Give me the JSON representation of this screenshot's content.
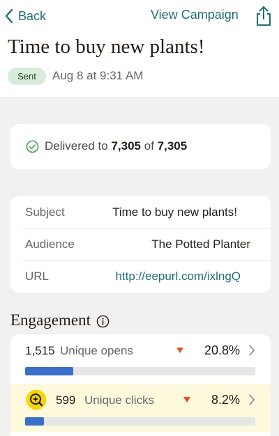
{
  "nav": {
    "back_label": "Back",
    "view_campaign_label": "View Campaign",
    "share_icon": "share-icon"
  },
  "campaign": {
    "title": "Time to buy new plants!",
    "status_badge": "Sent",
    "sent_date": "Aug 8 at 9:31 AM"
  },
  "delivery": {
    "prefix": "Delivered to",
    "delivered": "7,305",
    "of_word": "of",
    "total": "7,305",
    "icon": "check-circle-icon"
  },
  "details": [
    {
      "label": "Subject",
      "value": "Time to buy new plants!"
    },
    {
      "label": "Audience",
      "value": "The Potted Planter"
    },
    {
      "label": "URL",
      "value": "http://eepurl.com/ixlngQ"
    }
  ],
  "engagement": {
    "heading": "Engagement",
    "metrics": [
      {
        "count": "1,515",
        "label": "Unique opens",
        "percent": "20.8%",
        "rate": 0.208,
        "trend": "down",
        "bar_color": "#3a6fc9"
      },
      {
        "count": "599",
        "label": "Unique clicks",
        "percent": "8.2%",
        "rate": 0.082,
        "trend": "down",
        "bar_color": "#3a6fc9",
        "badge_icon": "sparkle-search-icon"
      }
    ]
  },
  "colors": {
    "accent": "#1f6f75",
    "trend_down": "#e0531f",
    "sent_badge_bg": "#d8ecd9",
    "highlight_row": "#fcf9dd",
    "badge_yellow": "#f5d50c"
  }
}
